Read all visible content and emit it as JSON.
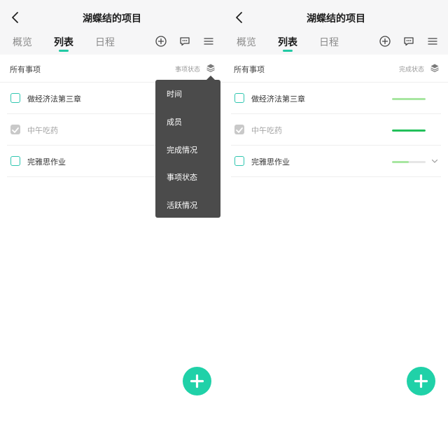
{
  "screens": [
    {
      "title": "湖蝶结的项目",
      "tabs": [
        "概览",
        "列表",
        "日程"
      ],
      "active_tab": "列表",
      "filter": {
        "title": "所有事项",
        "label": "事项状态"
      },
      "items": [
        {
          "label": "做经济法第三章",
          "done": false
        },
        {
          "label": "中午吃药",
          "done": true
        },
        {
          "label": "完雅思作业",
          "done": false
        }
      ],
      "menu": [
        "时间",
        "成员",
        "完成情况",
        "事项状态",
        "活跃情况"
      ]
    },
    {
      "title": "湖蝶结的项目",
      "tabs": [
        "概览",
        "列表",
        "日程"
      ],
      "active_tab": "列表",
      "filter": {
        "title": "所有事项",
        "label": "完成状态"
      },
      "items": [
        {
          "label": "做经济法第三章",
          "done": false,
          "progress": 1.0,
          "progress_color": "#a7e6a0"
        },
        {
          "label": "中午吃药",
          "done": true,
          "progress": 1.0,
          "progress_color": "#23c05a"
        },
        {
          "label": "完雅思作业",
          "done": false,
          "progress": 0.5,
          "progress_color": "#a7e6a0"
        }
      ]
    }
  ],
  "icons": {
    "back": "chevron-left-icon",
    "add": "add-circle-icon",
    "chat": "chat-bubble-icon",
    "menu": "hamburger-menu-icon",
    "layers": "layers-icon",
    "check": "checkmark-icon",
    "expand": "chevron-down-icon",
    "fab": "plus-icon"
  },
  "colors": {
    "accent": "#20d1a8",
    "checkbox_border": "#2fc6b0",
    "menu_bg": "#4b4b4b",
    "header_bg": "#f6f6f7"
  }
}
